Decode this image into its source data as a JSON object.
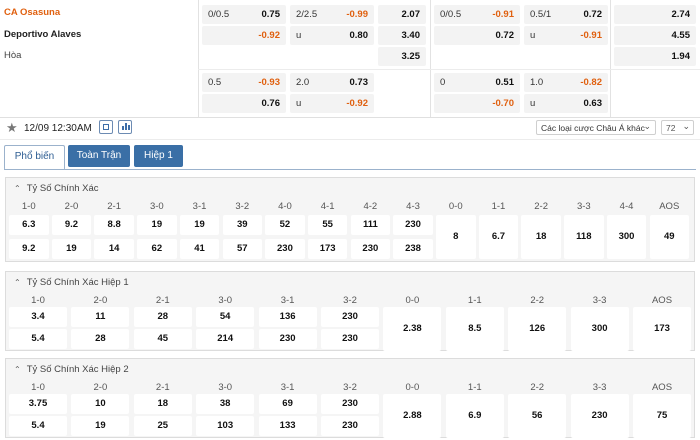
{
  "teams": {
    "home": "CA Osasuna",
    "away": "Deportivo Alaves",
    "draw": "Hòa"
  },
  "odds_top": {
    "row1": [
      {
        "label": "0/0.5",
        "value": "0.75",
        "neg": false
      },
      {
        "label": "2/2.5",
        "value": "-0.99",
        "neg": true
      },
      {
        "label": "",
        "value": "2.07",
        "neg": false
      },
      {
        "label": "0/0.5",
        "value": "-0.91",
        "neg": true
      },
      {
        "label": "0.5/1",
        "value": "0.72",
        "neg": false
      },
      {
        "label": "",
        "value": "2.74",
        "neg": false
      }
    ],
    "row2": [
      {
        "label": "",
        "value": "-0.92",
        "neg": true
      },
      {
        "label": "u",
        "value": "0.80",
        "neg": false
      },
      {
        "label": "",
        "value": "3.40",
        "neg": false
      },
      {
        "label": "",
        "value": "0.72",
        "neg": false
      },
      {
        "label": "u",
        "value": "-0.91",
        "neg": true
      },
      {
        "label": "",
        "value": "4.55",
        "neg": false
      }
    ],
    "row3": [
      {
        "label": "",
        "value": "3.25",
        "neg": false
      },
      {
        "label": "",
        "value": "1.94",
        "neg": false
      }
    ],
    "row4": [
      {
        "label": "0.5",
        "value": "-0.93",
        "neg": true
      },
      {
        "label": "2.0",
        "value": "0.73",
        "neg": false
      },
      {
        "label": "0",
        "value": "0.51",
        "neg": false
      },
      {
        "label": "1.0",
        "value": "-0.82",
        "neg": true
      }
    ],
    "row5": [
      {
        "label": "",
        "value": "0.76",
        "neg": false
      },
      {
        "label": "u",
        "value": "-0.92",
        "neg": true
      },
      {
        "label": "",
        "value": "-0.70",
        "neg": true
      },
      {
        "label": "u",
        "value": "0.63",
        "neg": false
      }
    ]
  },
  "toolbar": {
    "datetime": "12/09 12:30AM",
    "bet_type": "Các loại cược Châu Á khác",
    "count": "72"
  },
  "tabs": [
    "Phổ biến",
    "Toàn Trận",
    "Hiệp 1"
  ],
  "sections": [
    {
      "title": "Tỷ Số Chính Xác",
      "headers": [
        "1-0",
        "2-0",
        "2-1",
        "3-0",
        "3-1",
        "3-2",
        "4-0",
        "4-1",
        "4-2",
        "4-3",
        "0-0",
        "1-1",
        "2-2",
        "3-3",
        "4-4",
        "AOS"
      ],
      "row_a": [
        "6.3",
        "9.2",
        "8.8",
        "19",
        "19",
        "39",
        "52",
        "55",
        "111",
        "230"
      ],
      "row_b": [
        "9.2",
        "19",
        "14",
        "62",
        "41",
        "57",
        "230",
        "173",
        "230",
        "238"
      ],
      "draws": [
        "8",
        "6.7",
        "18",
        "118",
        "300",
        "49"
      ]
    },
    {
      "title": "Tỷ Số Chính Xác Hiệp 1",
      "headers": [
        "1-0",
        "2-0",
        "2-1",
        "3-0",
        "3-1",
        "3-2",
        "0-0",
        "1-1",
        "2-2",
        "3-3",
        "AOS"
      ],
      "row_a": [
        "3.4",
        "11",
        "28",
        "54",
        "136",
        "230"
      ],
      "row_b": [
        "5.4",
        "28",
        "45",
        "214",
        "230",
        "230"
      ],
      "draws": [
        "2.38",
        "8.5",
        "126",
        "300",
        "173"
      ]
    },
    {
      "title": "Tỷ Số Chính Xác Hiệp 2",
      "headers": [
        "1-0",
        "2-0",
        "2-1",
        "3-0",
        "3-1",
        "3-2",
        "0-0",
        "1-1",
        "2-2",
        "3-3",
        "AOS"
      ],
      "row_a": [
        "3.75",
        "10",
        "18",
        "38",
        "69",
        "230"
      ],
      "row_b": [
        "5.4",
        "19",
        "25",
        "103",
        "133",
        "230"
      ],
      "draws": [
        "2.88",
        "6.9",
        "56",
        "230",
        "75"
      ]
    }
  ],
  "colors": {
    "accent": "#3a6fa6",
    "negative": "#e0600f"
  }
}
